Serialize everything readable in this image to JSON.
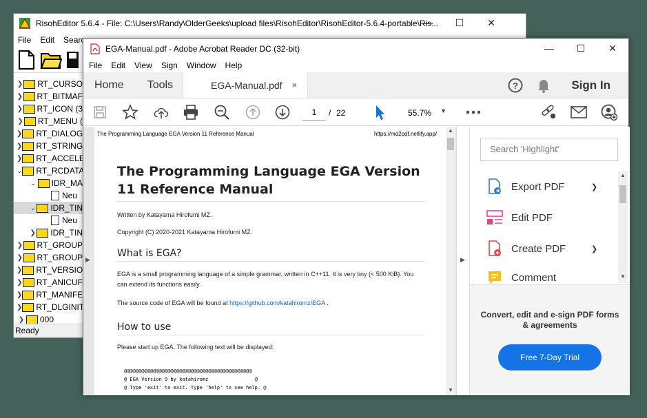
{
  "risoh": {
    "title": "RisohEditor 5.6.4 - File: C:\\Users\\Randy\\OlderGeeks\\upload files\\RisohEditor\\RisohEditor-5.6.4-portable\\Ris...",
    "menu": [
      "File",
      "Edit",
      "Searc"
    ],
    "tree": [
      {
        "label": "RT_CURSO",
        "indent": 0,
        "chev": ">",
        "type": "folder"
      },
      {
        "label": "RT_BITMAF",
        "indent": 0,
        "chev": ">",
        "type": "folder"
      },
      {
        "label": "RT_ICON (3",
        "indent": 0,
        "chev": ">",
        "type": "folder"
      },
      {
        "label": "RT_MENU (",
        "indent": 0,
        "chev": ">",
        "type": "folder"
      },
      {
        "label": "RT_DIALOG",
        "indent": 0,
        "chev": ">",
        "type": "folder"
      },
      {
        "label": "RT_STRING",
        "indent": 0,
        "chev": ">",
        "type": "folder"
      },
      {
        "label": "RT_ACCELE",
        "indent": 0,
        "chev": ">",
        "type": "folder"
      },
      {
        "label": "RT_RCDATA",
        "indent": 0,
        "chev": "v",
        "type": "folder"
      },
      {
        "label": "IDR_MA",
        "indent": 1,
        "chev": "v",
        "type": "folder"
      },
      {
        "label": "Neu",
        "indent": 2,
        "chev": "",
        "type": "doc"
      },
      {
        "label": "IDR_TIN",
        "indent": 1,
        "chev": "v",
        "type": "folder",
        "selected": true
      },
      {
        "label": "Neu",
        "indent": 2,
        "chev": "",
        "type": "doc"
      },
      {
        "label": "IDR_TIN",
        "indent": 1,
        "chev": ">",
        "type": "folder"
      },
      {
        "label": "RT_GROUP",
        "indent": 0,
        "chev": ">",
        "type": "folder"
      },
      {
        "label": "RT_GROUP",
        "indent": 0,
        "chev": ">",
        "type": "folder"
      },
      {
        "label": "RT_VERSIO",
        "indent": 0,
        "chev": ">",
        "type": "folder"
      },
      {
        "label": "RT_ANICUF",
        "indent": 0,
        "chev": ">",
        "type": "folder"
      },
      {
        "label": "RT_MANIFE",
        "indent": 0,
        "chev": ">",
        "type": "folder"
      },
      {
        "label": "RT_DLGINIT",
        "indent": 0,
        "chev": ">",
        "type": "folder"
      },
      {
        "label": "000",
        "indent": 0,
        "chev": ">",
        "type": "folder"
      }
    ],
    "status": "Ready"
  },
  "acrobat": {
    "title": "EGA-Manual.pdf - Adobe Acrobat Reader DC (32-bit)",
    "menu": [
      "File",
      "Edit",
      "View",
      "Sign",
      "Window",
      "Help"
    ],
    "tabs": {
      "home": "Home",
      "tools": "Tools",
      "doc": "EGA-Manual.pdf",
      "close": "×"
    },
    "sign_in": "Sign In",
    "page_current": "1",
    "page_sep": "/",
    "page_total": "22",
    "zoom": "55.7%",
    "search_placeholder": "Search 'Highlight'",
    "right_items": [
      {
        "label": "Export PDF",
        "icon": "export-pdf-icon",
        "color": "#2d7dd2",
        "has_chevron": true
      },
      {
        "label": "Edit PDF",
        "icon": "edit-pdf-icon",
        "color": "#e8428a",
        "has_chevron": false
      },
      {
        "label": "Create PDF",
        "icon": "create-pdf-icon",
        "color": "#e0454d",
        "has_chevron": true
      },
      {
        "label": "Comment",
        "icon": "comment-icon",
        "color": "#f2c01e",
        "has_chevron": false
      }
    ],
    "promo_text": "Convert, edit and e-sign PDF forms & agreements",
    "trial_button": "Free 7-Day Trial"
  },
  "document": {
    "header_left": "The Programming Language EGA Version 11 Reference Manual",
    "header_right": "https://md2pdf.netlify.app/",
    "title": "The Programming Language EGA Version 11 Reference Manual",
    "author": "Written by Katayama Hirofumi MZ.",
    "copyright": "Copyright (C) 2020-2021 Katayama Hirofumi MZ.",
    "h_what": "What is EGA?",
    "what_text": "EGA is a small programming language of a simple grammar, written in C++11. It is very tiny (< 500 KiB). You can extend its functions easily.",
    "source_prefix": "The source code of EGA will be found at ",
    "source_link": "https://github.com/katahiromz/EGA",
    "source_suffix": " .",
    "h_how": "How to use",
    "how_text": "Please start up EGA. The following text will be displayed:",
    "code_lines": [
      "@@@@@@@@@@@@@@@@@@@@@@@@@@@@@@@@@@@@@@@@@@@@",
      "@ EGA Version 9 by katahiromz                @",
      "@ Type 'exit' to exit. Type 'help' to see help. @"
    ]
  }
}
